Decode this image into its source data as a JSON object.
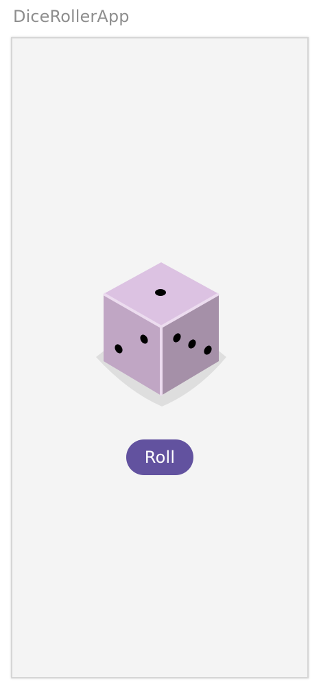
{
  "app": {
    "title": "DiceRollerApp"
  },
  "dice": {
    "icon": "dice-icon",
    "top_face_pips": 1,
    "left_face_pips": 2,
    "right_face_pips": 3,
    "colors": {
      "top": "#dcc2e2",
      "left": "#c0a6c4",
      "right": "#a590a8",
      "edge": "#ecdcef",
      "shadow": "#dedede",
      "pip": "#000000"
    }
  },
  "roll_button": {
    "label": "Roll",
    "color": "#62529f"
  }
}
